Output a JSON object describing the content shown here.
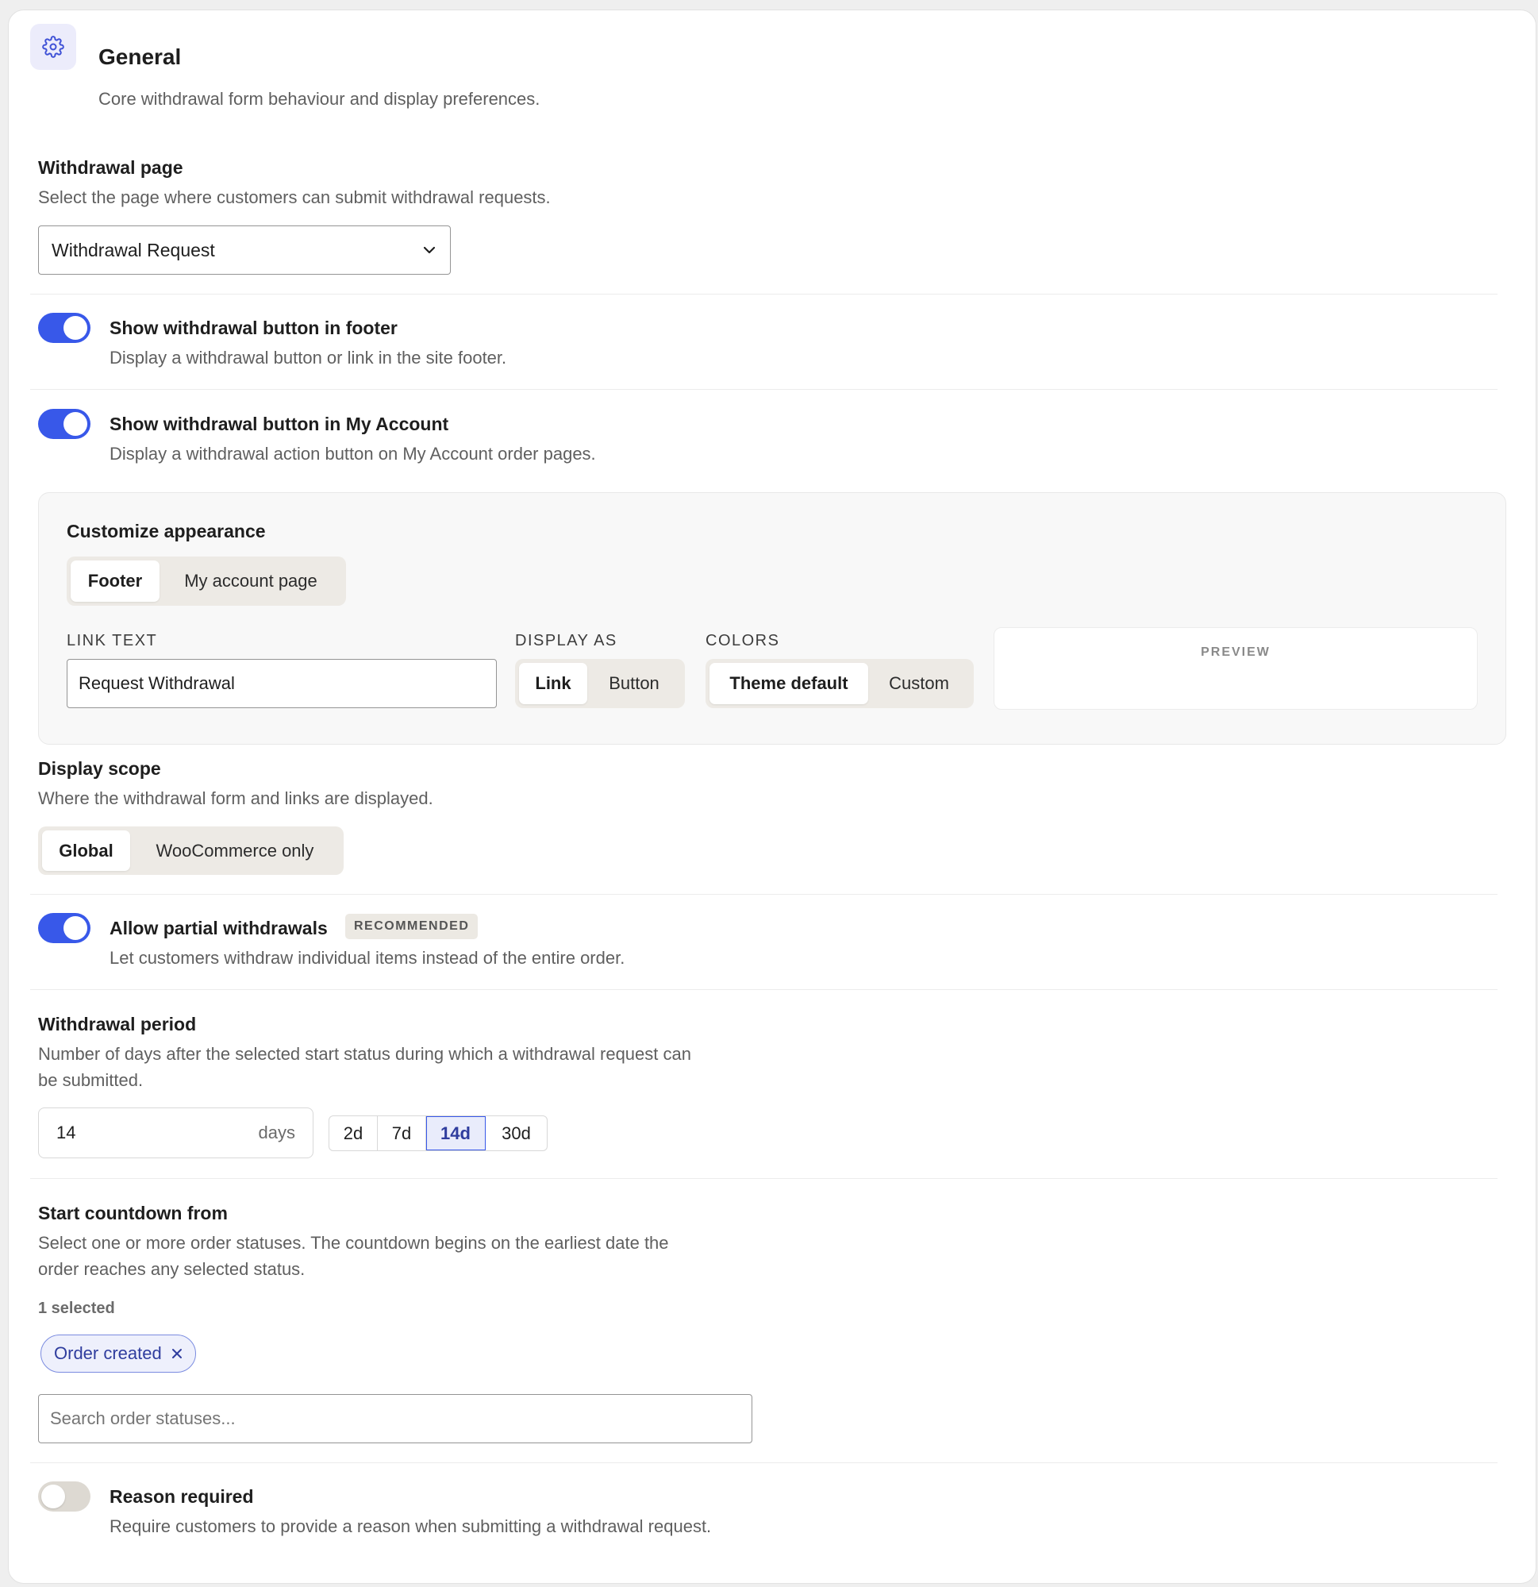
{
  "section": {
    "icon": "gear-icon",
    "title": "General",
    "description": "Core withdrawal form behaviour and display preferences."
  },
  "withdrawal_page": {
    "label": "Withdrawal page",
    "description": "Select the page where customers can submit withdrawal requests.",
    "selected": "Withdrawal Request"
  },
  "footer_button": {
    "label": "Show withdrawal button in footer",
    "description": "Display a withdrawal button or link in the site footer.",
    "enabled": true
  },
  "account_button": {
    "label": "Show withdrawal button in My Account",
    "description": "Display a withdrawal action button on My Account order pages.",
    "enabled": true
  },
  "customize": {
    "title": "Customize appearance",
    "tabs": [
      "Footer",
      "My account page"
    ],
    "active_tab": "Footer",
    "link_text_label": "LINK TEXT",
    "link_text_value": "Request Withdrawal",
    "display_as_label": "DISPLAY AS",
    "display_as_options": [
      "Link",
      "Button"
    ],
    "display_as_selected": "Link",
    "colors_label": "COLORS",
    "colors_options": [
      "Theme default",
      "Custom"
    ],
    "colors_selected": "Theme default",
    "preview_label": "PREVIEW"
  },
  "display_scope": {
    "label": "Display scope",
    "description": "Where the withdrawal form and links are displayed.",
    "options": [
      "Global",
      "WooCommerce only"
    ],
    "selected": "Global"
  },
  "partial": {
    "label": "Allow partial withdrawals",
    "badge": "RECOMMENDED",
    "description": "Let customers withdraw individual items instead of the entire order.",
    "enabled": true
  },
  "period": {
    "label": "Withdrawal period",
    "description_line1": "Number of days after the selected start status during which a withdrawal request can",
    "description_line2": "be submitted.",
    "value": "14",
    "unit": "days",
    "presets": [
      "2d",
      "7d",
      "14d",
      "30d"
    ],
    "selected_preset": "14d"
  },
  "countdown": {
    "label": "Start countdown from",
    "description_line1": "Select one or more order statuses. The countdown begins on the earliest date the",
    "description_line2": "order reaches any selected status.",
    "selected_count": "1 selected",
    "chips": [
      "Order created"
    ],
    "search_placeholder": "Search order statuses..."
  },
  "reason": {
    "label": "Reason required",
    "description": "Require customers to provide a reason when submitting a withdrawal request.",
    "enabled": false
  },
  "colors": {
    "accent": "#3858e9",
    "toggle_off": "#ddd9d2",
    "chip_text": "#2f3d9e"
  }
}
